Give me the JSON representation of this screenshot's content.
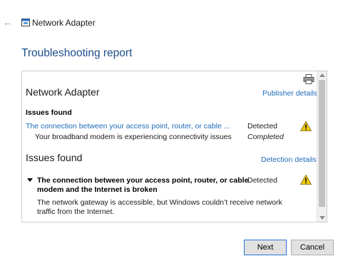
{
  "window": {
    "title": "Network Adapter",
    "back_icon": "back-arrow-icon",
    "app_icon": "network-adapter-icon"
  },
  "page": {
    "heading": "Troubleshooting report"
  },
  "report": {
    "adapter_title": "Network Adapter",
    "publisher_link": "Publisher details",
    "issues_found_label": "Issues found",
    "issues": [
      {
        "text": "The connection between your access point, router, or cable ...",
        "status": "Detected",
        "icon": "warning-icon"
      },
      {
        "text": "Your broadband modem is experiencing connectivity issues",
        "status": "Completed"
      }
    ],
    "detail_section_title": "Issues found",
    "detection_link": "Detection details",
    "detail": {
      "title_line1": "The connection between your access point, router, or cable",
      "title_line2": "modem and the Internet is broken",
      "status": "Detected",
      "desc_line1": "The network gateway is accessible, but Windows couldn’t receive network",
      "desc_line2": "traffic from the Internet."
    }
  },
  "buttons": {
    "next": "Next",
    "cancel": "Cancel"
  },
  "colors": {
    "heading_blue": "#1e4e8c",
    "link_blue": "#1e6bb8",
    "warning_yellow": "#f2c811"
  }
}
